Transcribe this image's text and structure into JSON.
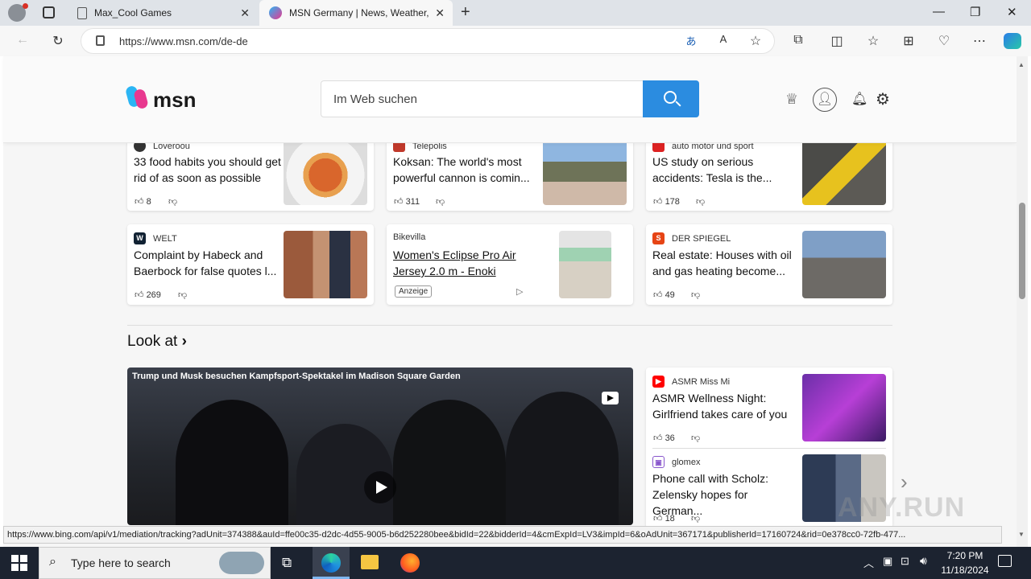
{
  "browser": {
    "tabs": [
      {
        "title": "Max_Cool Games"
      },
      {
        "title": "MSN Germany | News, Weather, S"
      }
    ],
    "url": "https://www.msn.com/de-de"
  },
  "header": {
    "logo": "msn",
    "search_placeholder": "Im Web suchen"
  },
  "row1": [
    {
      "source": "Loveroou",
      "title": "33 food habits you should get rid of as soon as possible",
      "likes": "8"
    },
    {
      "source": "Telepolis",
      "title": "Koksan: The world's most powerful cannon is comin...",
      "likes": "311"
    },
    {
      "source": "auto motor und sport",
      "title": "US study on serious accidents: Tesla is the...",
      "likes": "178"
    }
  ],
  "row2": [
    {
      "source": "WELT",
      "title": "Complaint by Habeck and Baerbock for false quotes l...",
      "likes": "269"
    },
    {
      "source": "Bikevilla",
      "title": "Women's Eclipse Pro Air Jersey 2.0 m - Enoki",
      "badge": "Anzeige"
    },
    {
      "source": "DER SPIEGEL",
      "title": "Real estate: Houses with oil and gas heating become...",
      "likes": "49"
    }
  ],
  "section": {
    "title": "Look at"
  },
  "video": {
    "caption": "Trump und Musk besuchen Kampfsport-Spektakel im Madison Square Garden"
  },
  "side": [
    {
      "source": "ASMR Miss Mi",
      "title": "ASMR Wellness Night: Girlfriend takes care of you",
      "likes": "36"
    },
    {
      "source": "glomex",
      "title": "Phone call with Scholz: Zelensky hopes for German...",
      "likes": "18"
    }
  ],
  "statusbar": "https://www.bing.com/api/v1/mediation/tracking?adUnit=374388&auId=ffe00c35-d2dc-4d55-9005-b6d252280bee&bidId=22&bidderId=4&cmExpId=LV3&impId=6&oAdUnit=367171&publisherId=17160724&rid=0e378cc0-72fb-477...",
  "taskbar": {
    "search_placeholder": "Type here to search",
    "time": "7:20 PM",
    "date": "11/18/2024"
  },
  "watermark": "ANY.RUN"
}
